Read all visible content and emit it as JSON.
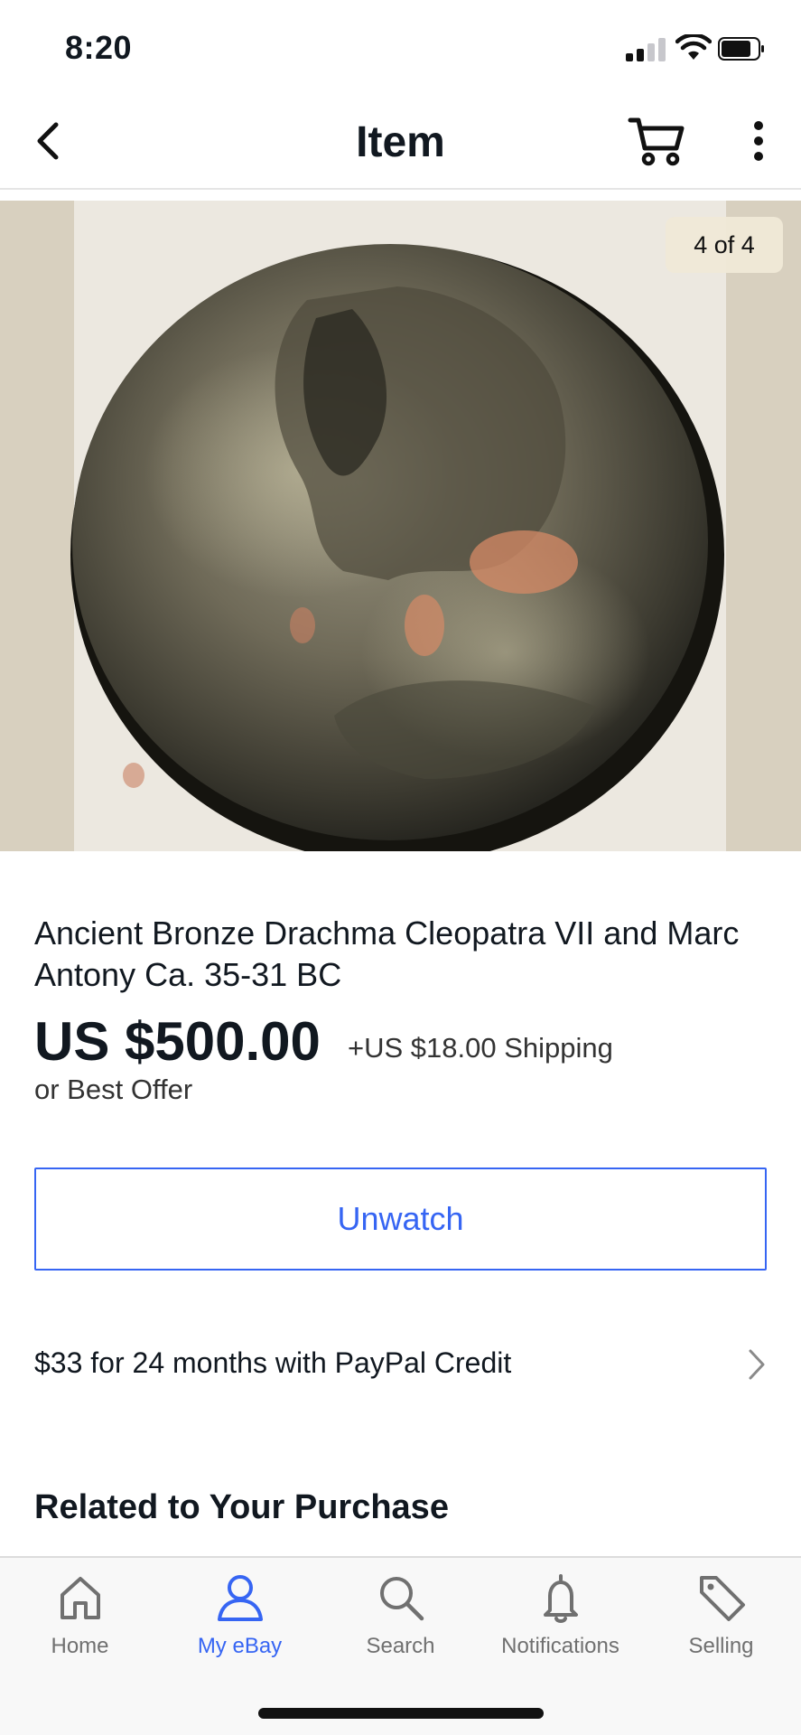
{
  "status_bar": {
    "time": "8:20"
  },
  "nav": {
    "title": "Item"
  },
  "image": {
    "counter": "4 of 4"
  },
  "item": {
    "title": "Ancient Bronze Drachma Cleopatra VII and Marc Antony Ca. 35-31 BC",
    "price": "US $500.00",
    "shipping": "+US $18.00 Shipping",
    "best_offer": "or Best Offer",
    "unwatch_label": "Unwatch",
    "credit_text": "$33 for 24 months with PayPal Credit"
  },
  "related": {
    "heading": "Related to Your Purchase"
  },
  "tabs": [
    {
      "label": "Home",
      "icon": "home-icon",
      "active": false
    },
    {
      "label": "My eBay",
      "icon": "person-icon",
      "active": true
    },
    {
      "label": "Search",
      "icon": "search-icon",
      "active": false
    },
    {
      "label": "Notifications",
      "icon": "bell-icon",
      "active": false
    },
    {
      "label": "Selling",
      "icon": "tag-icon",
      "active": false
    }
  ],
  "colors": {
    "accent": "#3665f3",
    "text": "#111820",
    "muted": "#707070"
  }
}
